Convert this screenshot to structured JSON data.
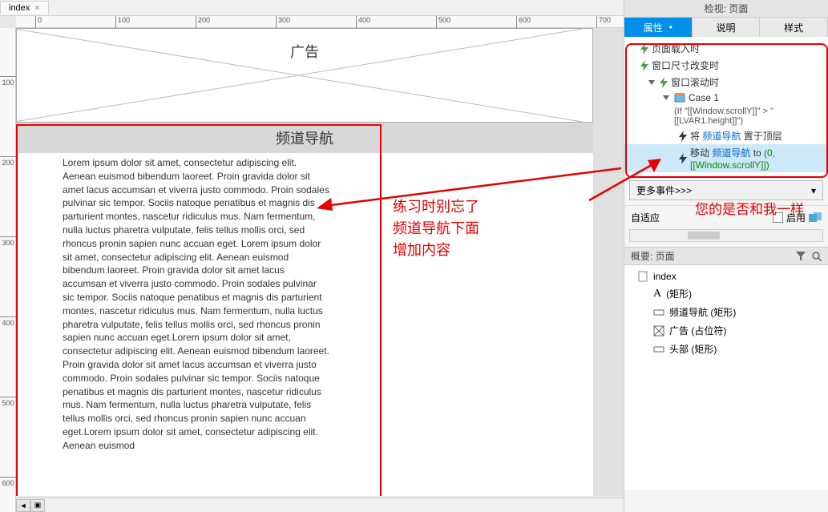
{
  "tab": {
    "name": "index",
    "close": "×"
  },
  "ruler_h": [
    0,
    100,
    200,
    300,
    400,
    500,
    600,
    700
  ],
  "ruler_v": [
    100,
    200,
    300,
    400,
    500,
    600
  ],
  "page_elements": {
    "ad_label": "广告",
    "channel_nav": "频道导航",
    "lorem": "Lorem ipsum dolor sit amet, consectetur adipiscing elit. Aenean euismod bibendum laoreet. Proin gravida dolor sit amet lacus accumsan et viverra justo commodo. Proin sodales pulvinar sic tempor. Sociis natoque penatibus et magnis dis parturient montes, nascetur ridiculus mus. Nam fermentum, nulla luctus pharetra vulputate, felis tellus mollis orci, sed rhoncus pronin sapien nunc accuan eget. Lorem ipsum dolor sit amet, consectetur adipiscing elit. Aenean euismod bibendum laoreet. Proin gravida dolor sit amet lacus accumsan et viverra justo commodo. Proin sodales pulvinar sic tempor. Sociis natoque penatibus et magnis dis parturient montes, nascetur ridiculus mus. Nam fermentum, nulla luctus pharetra vulputate, felis tellus mollis orci, sed rhoncus pronin sapien nunc accuan eget.Lorem ipsum dolor sit amet, consectetur adipiscing elit. Aenean euismod bibendum laoreet. Proin gravida dolor sit amet lacus accumsan et viverra justo commodo. Proin sodales pulvinar sic tempor. Sociis natoque penatibus et magnis dis parturient montes, nascetur ridiculus mus. Nam fermentum, nulla luctus pharetra vulputate, felis tellus mollis orci, sed rhoncus pronin sapien nunc accuan eget.Lorem ipsum dolor sit amet, consectetur adipiscing elit. Aenean euismod"
  },
  "annotation_canvas": "练习时别忘了\n频道导航下面\n增加内容",
  "right_panel": {
    "inspector_title": "检视: 页面",
    "tabs": {
      "properties": "属性",
      "notes": "说明",
      "style": "样式"
    },
    "events": {
      "page_load": "页面载入时",
      "window_resize": "窗口尺寸改变时",
      "window_scroll": "窗口滚动时",
      "case1": "Case 1",
      "case1_cond": "(If \"[[Window.scrollY]]\" > \"[[LVAR1.height]]\")",
      "action1_pre": "将 ",
      "action1_link": "频道导航",
      "action1_post": " 置于顶层",
      "action2_pre": "移动 ",
      "action2_link": "频道导航",
      "action2_post": " to ",
      "action2_expr": "(0, [[Window.scrollY]])"
    },
    "more_events": "更多事件>>>",
    "adaptive": "自适应",
    "enable": "启用",
    "outline_title": "概要: 页面",
    "outline": {
      "index": "index",
      "rect": "(矩形)",
      "channel_nav": "频道导航 (矩形)",
      "ad": "广告 (占位符)",
      "header": "头部 (矩形)"
    }
  },
  "annotation_right": "您的是否和我一样",
  "colors": {
    "red": "#e60000",
    "blue_tab": "#008ee8",
    "link": "#0066cc",
    "green": "#0a8a0a"
  }
}
